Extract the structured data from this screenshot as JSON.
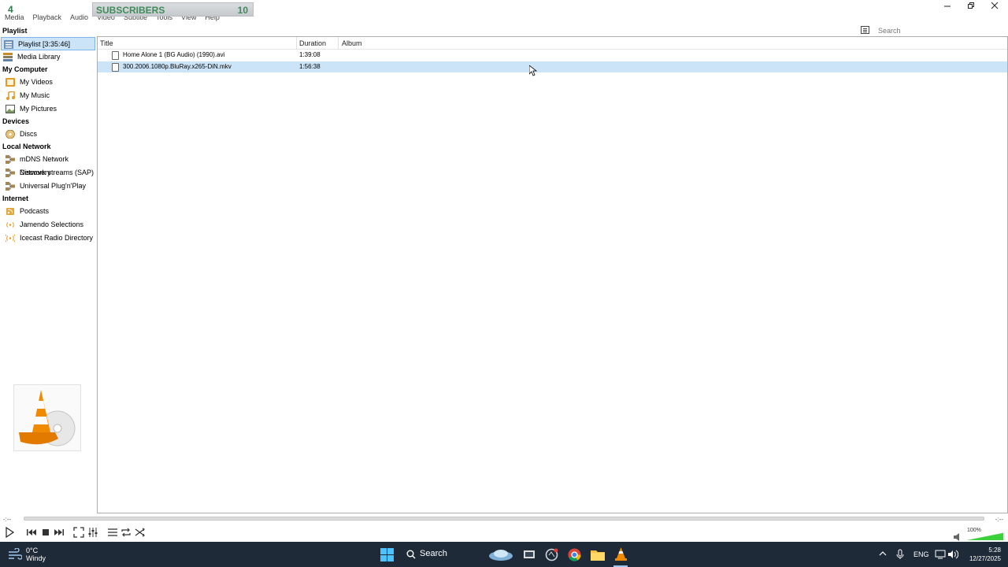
{
  "overlay": {
    "number": "4",
    "subscribers_label": "SUBSCRIBERS",
    "subscribers_count": "10"
  },
  "menu": [
    "Media",
    "Playback",
    "Audio",
    "Video",
    "Subtitle",
    "Tools",
    "View",
    "Help"
  ],
  "sidebar": {
    "sections": [
      {
        "title": "Playlist",
        "items": [
          {
            "label": "Playlist [3:35:46]",
            "icon": "playlist-icon",
            "selected": true
          },
          {
            "label": "Media Library",
            "icon": "media-library-icon"
          }
        ]
      },
      {
        "title": "My Computer",
        "items": [
          {
            "label": "My Videos",
            "icon": "videos-icon"
          },
          {
            "label": "My Music",
            "icon": "music-icon"
          },
          {
            "label": "My Pictures",
            "icon": "pictures-icon"
          }
        ]
      },
      {
        "title": "Devices",
        "items": [
          {
            "label": "Discs",
            "icon": "disc-icon"
          }
        ]
      },
      {
        "title": "Local Network",
        "items": [
          {
            "label": "mDNS Network Discovery",
            "icon": "network-icon"
          },
          {
            "label": "Network streams (SAP)",
            "icon": "network-icon"
          },
          {
            "label": "Universal Plug'n'Play",
            "icon": "network-icon"
          }
        ]
      },
      {
        "title": "Internet",
        "items": [
          {
            "label": "Podcasts",
            "icon": "podcast-icon"
          },
          {
            "label": "Jamendo Selections",
            "icon": "radio-icon"
          },
          {
            "label": "Icecast Radio Directory",
            "icon": "radio-icon"
          }
        ]
      }
    ]
  },
  "playlist": {
    "columns": [
      "Title",
      "Duration",
      "Album"
    ],
    "rows": [
      {
        "title": "Home Alone 1 (BG Audio) (1990).avi",
        "duration": "1:39:08",
        "album": ""
      },
      {
        "title": "300.2006.1080p.BluRay.x265-DiN.mkv",
        "duration": "1:56:38",
        "album": "",
        "selected": true
      }
    ]
  },
  "search": {
    "placeholder": "Search"
  },
  "player": {
    "time_elapsed": "-:--",
    "time_total": "-:--",
    "volume": "100%"
  },
  "taskbar": {
    "weather_temp": "0°C",
    "weather_desc": "Windy",
    "search_label": "Search",
    "language": "ENG",
    "time": "5:28",
    "date": "12/27/2025"
  },
  "colors": {
    "accent": "#cce4f7",
    "accent_border": "#7eb4ea",
    "taskbar": "#1f2a38",
    "vlc_orange": "#f08a00"
  }
}
